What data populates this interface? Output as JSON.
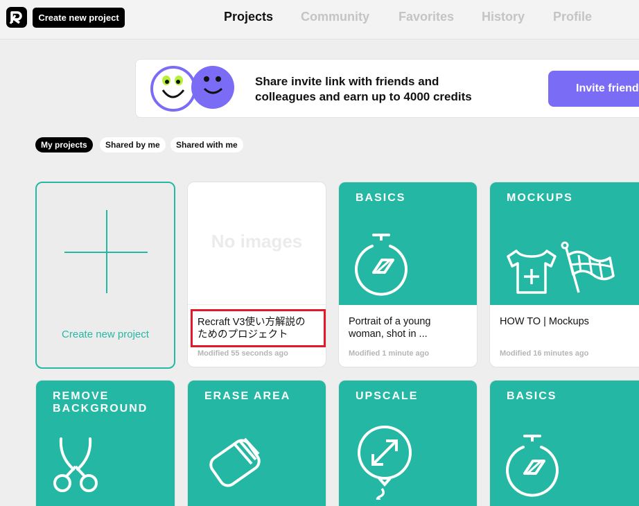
{
  "header": {
    "create_label": "Create new project",
    "nav": [
      {
        "label": "Projects",
        "active": true
      },
      {
        "label": "Community",
        "active": false
      },
      {
        "label": "Favorites",
        "active": false
      },
      {
        "label": "History",
        "active": false
      },
      {
        "label": "Profile",
        "active": false
      }
    ]
  },
  "banner": {
    "text_line1": "Share invite link with friends and",
    "text_line2": "colleagues and earn up to 4000 credits",
    "button_label": "Invite friends"
  },
  "filters": [
    {
      "label": "My projects",
      "active": true
    },
    {
      "label": "Shared by me",
      "active": false
    },
    {
      "label": "Shared with me",
      "active": false
    }
  ],
  "create_card": {
    "label": "Create new project"
  },
  "projects": [
    {
      "placeholder": "No images",
      "title": "Recraft V3使い方解説のためのプロジェクト",
      "title_line1": "Recraft V3使い方解説の",
      "title_line2": "ためのプロジェクト",
      "modified": "Modified 55 seconds ago"
    },
    {
      "category": "BASICS",
      "title_line1": "Portrait of a young",
      "title_line2": "woman, shot in ...",
      "modified": "Modified 1 minute ago",
      "icon": "stopwatch-icon"
    },
    {
      "category": "MOCKUPS",
      "title_line1": "HOW TO | Mockups",
      "modified": "Modified 16 minutes ago",
      "icon": "tshirt-flag-icon"
    }
  ],
  "templates": [
    {
      "category_line1": "REMOVE",
      "category_line2": "BACKGROUND",
      "icon": "scissors-icon"
    },
    {
      "category_line1": "ERASE AREA",
      "icon": "eraser-icon"
    },
    {
      "category_line1": "UPSCALE",
      "icon": "upscale-balloon-icon"
    },
    {
      "category_line1": "BASICS",
      "icon": "stopwatch-icon"
    }
  ],
  "colors": {
    "teal": "#24b8a4",
    "purple": "#7b6cf6",
    "highlight": "#e3182b"
  }
}
